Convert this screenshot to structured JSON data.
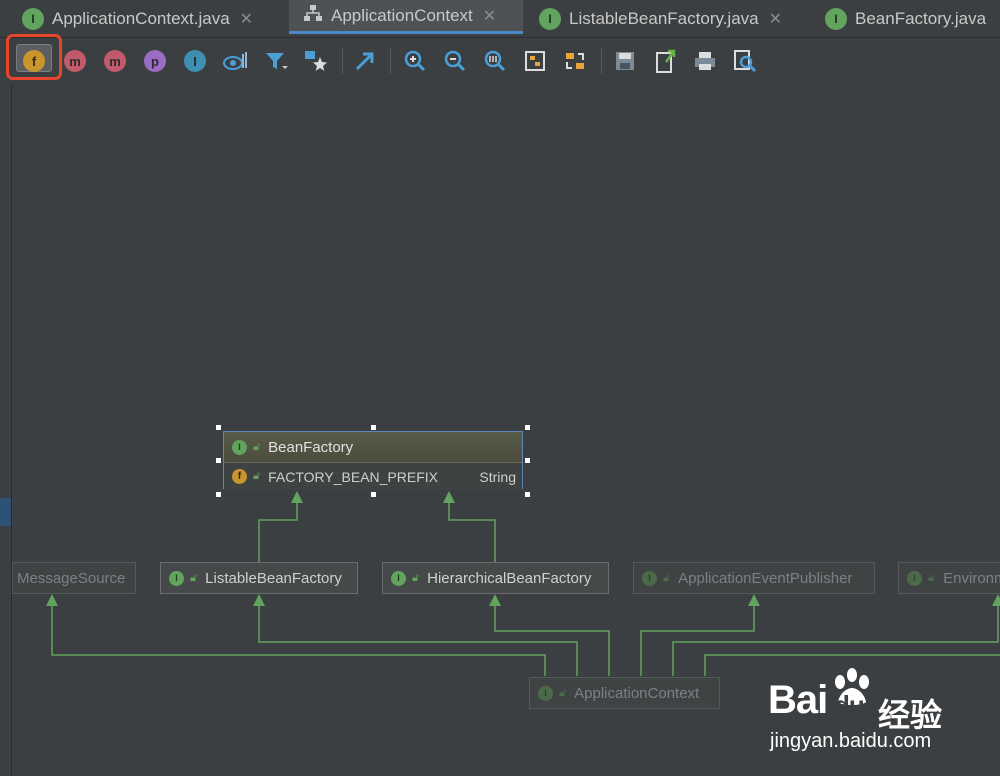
{
  "tabs": [
    {
      "label": "ApplicationContext.java",
      "icon": "interface-icon"
    },
    {
      "label": "ApplicationContext",
      "icon": "hierarchy-icon"
    },
    {
      "label": "ListableBeanFactory.java",
      "icon": "interface-icon"
    },
    {
      "label": "BeanFactory.java",
      "icon": "interface-icon"
    }
  ],
  "toolbar": {
    "fields_letter": "f",
    "methods_letter": "m",
    "properties_letter": "p",
    "inner_letter": "I",
    "buttons": [
      "show-fields",
      "show-constructors",
      "show-methods",
      "show-properties",
      "show-inner-classes",
      "change-visibility",
      "filter",
      "show-dependencies",
      "jump-to-source",
      "zoom-in",
      "zoom-out",
      "actual-size",
      "fit-content",
      "apply-layout",
      "save-diagram",
      "export",
      "print",
      "find"
    ]
  },
  "diagram": {
    "bean_factory": {
      "title": "BeanFactory",
      "field_name": "FACTORY_BEAN_PREFIX",
      "field_type": "String"
    },
    "nodes": {
      "message_source": "MessageSource",
      "listable_bean_factory": "ListableBeanFactory",
      "hierarchical_bean_factory": "HierarchicalBeanFactory",
      "application_event_publisher": "ApplicationEventPublisher",
      "environment": "Environm",
      "application_context": "ApplicationContext"
    },
    "interface_letter": "I",
    "field_letter": "f",
    "edge_color": "#62a35e"
  },
  "watermark": {
    "brand": "Bai",
    "brand2": "du",
    "cn": "经验",
    "url": "jingyan.baidu.com"
  }
}
